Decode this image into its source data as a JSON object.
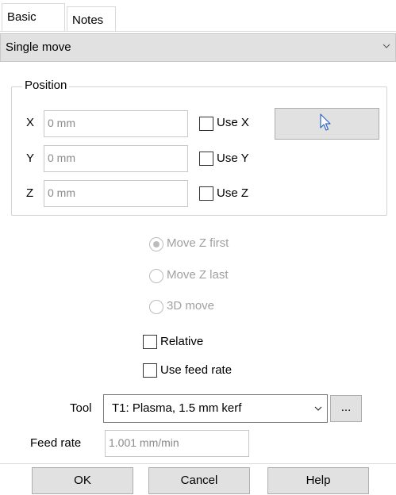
{
  "tabs": [
    {
      "label": "Basic",
      "active": true
    },
    {
      "label": "Notes",
      "active": false
    }
  ],
  "mode": {
    "selected": "Single move"
  },
  "position": {
    "legend": "Position",
    "rows": [
      {
        "axis": "X",
        "value": "0 mm",
        "use_label": "Use X",
        "checked": false
      },
      {
        "axis": "Y",
        "value": "0 mm",
        "use_label": "Use Y",
        "checked": false
      },
      {
        "axis": "Z",
        "value": "0 mm",
        "use_label": "Use Z",
        "checked": false
      }
    ],
    "pick_button_icon": "cursor-arrow-icon"
  },
  "move_options": [
    {
      "label": "Move Z first",
      "selected": true,
      "enabled": false
    },
    {
      "label": "Move Z last",
      "selected": false,
      "enabled": false
    },
    {
      "label": "3D move",
      "selected": false,
      "enabled": false
    }
  ],
  "checks": {
    "relative": {
      "label": "Relative",
      "checked": false
    },
    "use_feed_rate": {
      "label": "Use feed rate",
      "checked": false
    }
  },
  "tool": {
    "label": "Tool",
    "selected": "T1: Plasma, 1.5 mm kerf",
    "more_label": "..."
  },
  "feed_rate": {
    "label": "Feed rate",
    "value": "1.001 mm/min"
  },
  "buttons": {
    "ok": "OK",
    "cancel": "Cancel",
    "help": "Help"
  },
  "colors": {
    "button_face": "#e1e1e1",
    "disabled_text": "#a0a0a0",
    "field_text": "#8a8a8a"
  }
}
